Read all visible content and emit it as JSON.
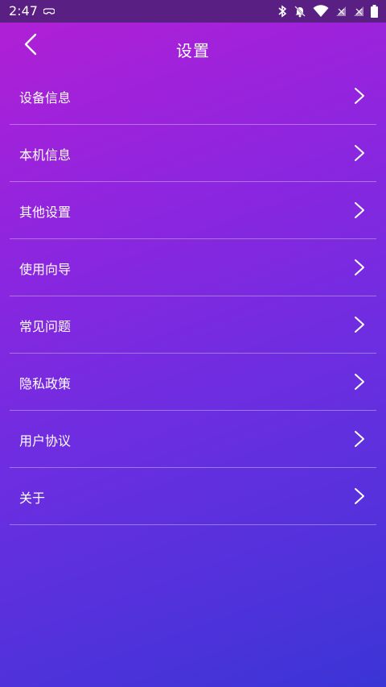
{
  "status_bar": {
    "time": "2:47",
    "left_icon": "gamepad-icon",
    "right_icons": [
      "bluetooth-icon",
      "notifications-off-icon",
      "wifi-icon",
      "no-signal-icon",
      "no-signal-icon",
      "battery-icon"
    ]
  },
  "header": {
    "title": "设置",
    "back_icon": "chevron-left-icon"
  },
  "menu": {
    "items": [
      {
        "label": "设备信息"
      },
      {
        "label": "本机信息"
      },
      {
        "label": "其他设置"
      },
      {
        "label": "使用向导"
      },
      {
        "label": "常见问题"
      },
      {
        "label": "隐私政策"
      },
      {
        "label": "用户协议"
      },
      {
        "label": "关于"
      }
    ],
    "chevron_icon": "chevron-right-icon"
  },
  "colors": {
    "status_bar": "#5a1f83",
    "gradient_start": "#b31fd4",
    "gradient_end": "#3b35d6",
    "text": "#ffffff"
  }
}
